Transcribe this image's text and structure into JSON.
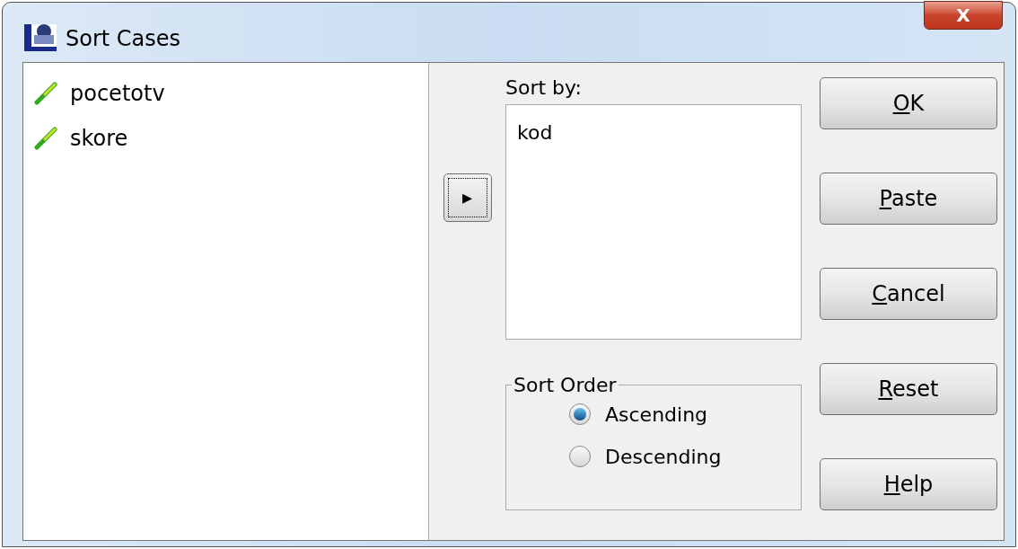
{
  "window": {
    "title": "Sort Cases",
    "close_label": "X"
  },
  "variables": [
    {
      "name": "pocetotv"
    },
    {
      "name": "skore"
    }
  ],
  "move_button": {
    "label": "▸"
  },
  "sort_by": {
    "label": "Sort by:",
    "items": [
      "kod"
    ]
  },
  "sort_order": {
    "title": "Sort Order",
    "options": [
      {
        "label": "Ascending",
        "selected": true
      },
      {
        "label": "Descending",
        "selected": false
      }
    ]
  },
  "buttons": [
    {
      "label": "OK",
      "mnemonic_underlined": true
    },
    {
      "label": "Paste",
      "mnemonic_underlined": true
    },
    {
      "label": "Cancel",
      "mnemonic_underlined": true
    },
    {
      "label": "Reset",
      "mnemonic_underlined": true
    },
    {
      "label": "Help",
      "mnemonic_underlined": true
    }
  ]
}
